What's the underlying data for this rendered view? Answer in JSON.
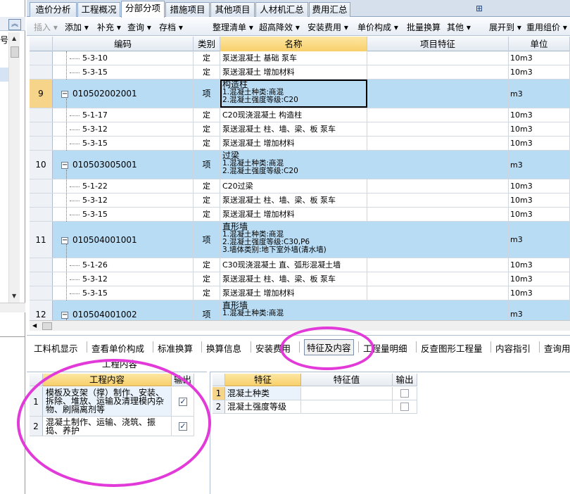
{
  "left_panel": {
    "partial_char": "号"
  },
  "tabs": [
    {
      "label": "造价分析",
      "active": false
    },
    {
      "label": "工程概况",
      "active": false
    },
    {
      "label": "分部分项",
      "active": true
    },
    {
      "label": "措施项目",
      "active": false
    },
    {
      "label": "其他项目",
      "active": false
    },
    {
      "label": "人材机汇总",
      "active": false
    },
    {
      "label": "费用汇总",
      "active": false
    }
  ],
  "toolbar": [
    {
      "label": "插入 ▾",
      "disabled": true
    },
    {
      "label": "添加 ▾",
      "disabled": false
    },
    {
      "label": "补充 ▾",
      "disabled": false
    },
    {
      "label": "查询 ▾",
      "disabled": false
    },
    {
      "label": "存档 ▾",
      "disabled": false
    },
    {
      "label": "整理清单 ▾",
      "disabled": false
    },
    {
      "label": "超高降效 ▾",
      "disabled": false
    },
    {
      "label": "安装费用 ▾",
      "disabled": false
    },
    {
      "label": "单价构成 ▾",
      "disabled": false
    },
    {
      "label": "批量换算",
      "disabled": false
    },
    {
      "label": "其他 ▾",
      "disabled": false
    },
    {
      "label": "展开到 ▾",
      "disabled": false
    },
    {
      "label": "重用组价 ▾",
      "disabled": false
    }
  ],
  "grid": {
    "headers": [
      "编码",
      "类别",
      "名称",
      "项目特征",
      "单位"
    ],
    "rows": [
      {
        "kind": "sub",
        "idx": "",
        "code": "5-3-10",
        "type": "定",
        "name": [
          "泵送混凝土 基础 泵车"
        ],
        "unit": "10m3"
      },
      {
        "kind": "sub",
        "idx": "",
        "code": "5-3-15",
        "type": "定",
        "name": [
          "泵送混凝土 增加材料"
        ],
        "unit": "10m3"
      },
      {
        "kind": "item",
        "idx": "9",
        "code": "010502002001",
        "type": "项",
        "name": [
          "构造柱",
          "1.混凝土种类:商混",
          "2.混凝土强度等级:C20"
        ],
        "unit": "m3",
        "selected": true
      },
      {
        "kind": "sub",
        "idx": "",
        "code": "5-1-17",
        "type": "定",
        "name": [
          "C20现浇混凝土 构造柱"
        ],
        "unit": "10m3"
      },
      {
        "kind": "sub",
        "idx": "",
        "code": "5-3-12",
        "type": "定",
        "name": [
          "泵送混凝土 柱、墙、梁、板 泵车"
        ],
        "unit": "10m3"
      },
      {
        "kind": "sub",
        "idx": "",
        "code": "5-3-15",
        "type": "定",
        "name": [
          "泵送混凝土 增加材料"
        ],
        "unit": "10m3"
      },
      {
        "kind": "item",
        "idx": "10",
        "code": "010503005001",
        "type": "项",
        "name": [
          "过梁",
          "1.混凝土种类:商混",
          "2.混凝土强度等级:C20"
        ],
        "unit": "m3"
      },
      {
        "kind": "sub",
        "idx": "",
        "code": "5-1-22",
        "type": "定",
        "name": [
          "C20过梁"
        ],
        "unit": "10m3"
      },
      {
        "kind": "sub",
        "idx": "",
        "code": "5-3-12",
        "type": "定",
        "name": [
          "泵送混凝土 柱、墙、梁、板 泵车"
        ],
        "unit": "10m3"
      },
      {
        "kind": "sub",
        "idx": "",
        "code": "5-3-15",
        "type": "定",
        "name": [
          "泵送混凝土 增加材料"
        ],
        "unit": "10m3"
      },
      {
        "kind": "item",
        "idx": "11",
        "code": "010504001001",
        "type": "项",
        "name": [
          "直形墙",
          "1.混凝土种类:商混",
          "2.混凝土强度等级:C30,P6",
          "3.墙体类别:地下室外墙(清水墙)"
        ],
        "unit": "m3"
      },
      {
        "kind": "sub",
        "idx": "",
        "code": "5-1-26",
        "type": "定",
        "name": [
          "C30现浇混凝土 直、弧形混凝土墙"
        ],
        "unit": "10m3"
      },
      {
        "kind": "sub",
        "idx": "",
        "code": "5-3-12",
        "type": "定",
        "name": [
          "泵送混凝土 柱、墙、梁、板 泵车"
        ],
        "unit": "10m3"
      },
      {
        "kind": "sub",
        "idx": "",
        "code": "5-3-15",
        "type": "定",
        "name": [
          "泵送混凝土 增加材料"
        ],
        "unit": "10m3"
      },
      {
        "kind": "item",
        "idx": "12",
        "code": "010504001002",
        "type": "项",
        "name": [
          "直形墙",
          "1.混凝土种类:商混"
        ],
        "unit": "m3"
      }
    ]
  },
  "bottom_tabs": [
    {
      "label": "工料机显示",
      "active": false
    },
    {
      "label": "查看单价构成",
      "active": false
    },
    {
      "label": "标准换算",
      "active": false
    },
    {
      "label": "换算信息",
      "active": false
    },
    {
      "label": "安装费用",
      "active": false
    },
    {
      "label": "特征及内容",
      "active": true
    },
    {
      "label": "工程量明细",
      "active": false
    },
    {
      "label": "反查图形工程量",
      "active": false
    },
    {
      "label": "内容指引",
      "active": false
    },
    {
      "label": "查询用",
      "active": false
    }
  ],
  "work_content": {
    "title": "工程内容",
    "headers": [
      "工程内容",
      "输出"
    ],
    "rows": [
      {
        "idx": "1",
        "text": "模板及支架（撑）制作、安装、拆除、堆放、运输及清理模内杂物、刷隔离剂等",
        "checked": true
      },
      {
        "idx": "2",
        "text": "混凝土制作、运输、浇筑、振捣、养护",
        "checked": true
      }
    ]
  },
  "features": {
    "headers": [
      "特征",
      "特征值",
      "输出"
    ],
    "rows": [
      {
        "idx": "1",
        "name": "混凝土种类",
        "value": "",
        "checked": false
      },
      {
        "idx": "2",
        "name": "混凝土强度等级",
        "value": "",
        "checked": false
      }
    ]
  }
}
